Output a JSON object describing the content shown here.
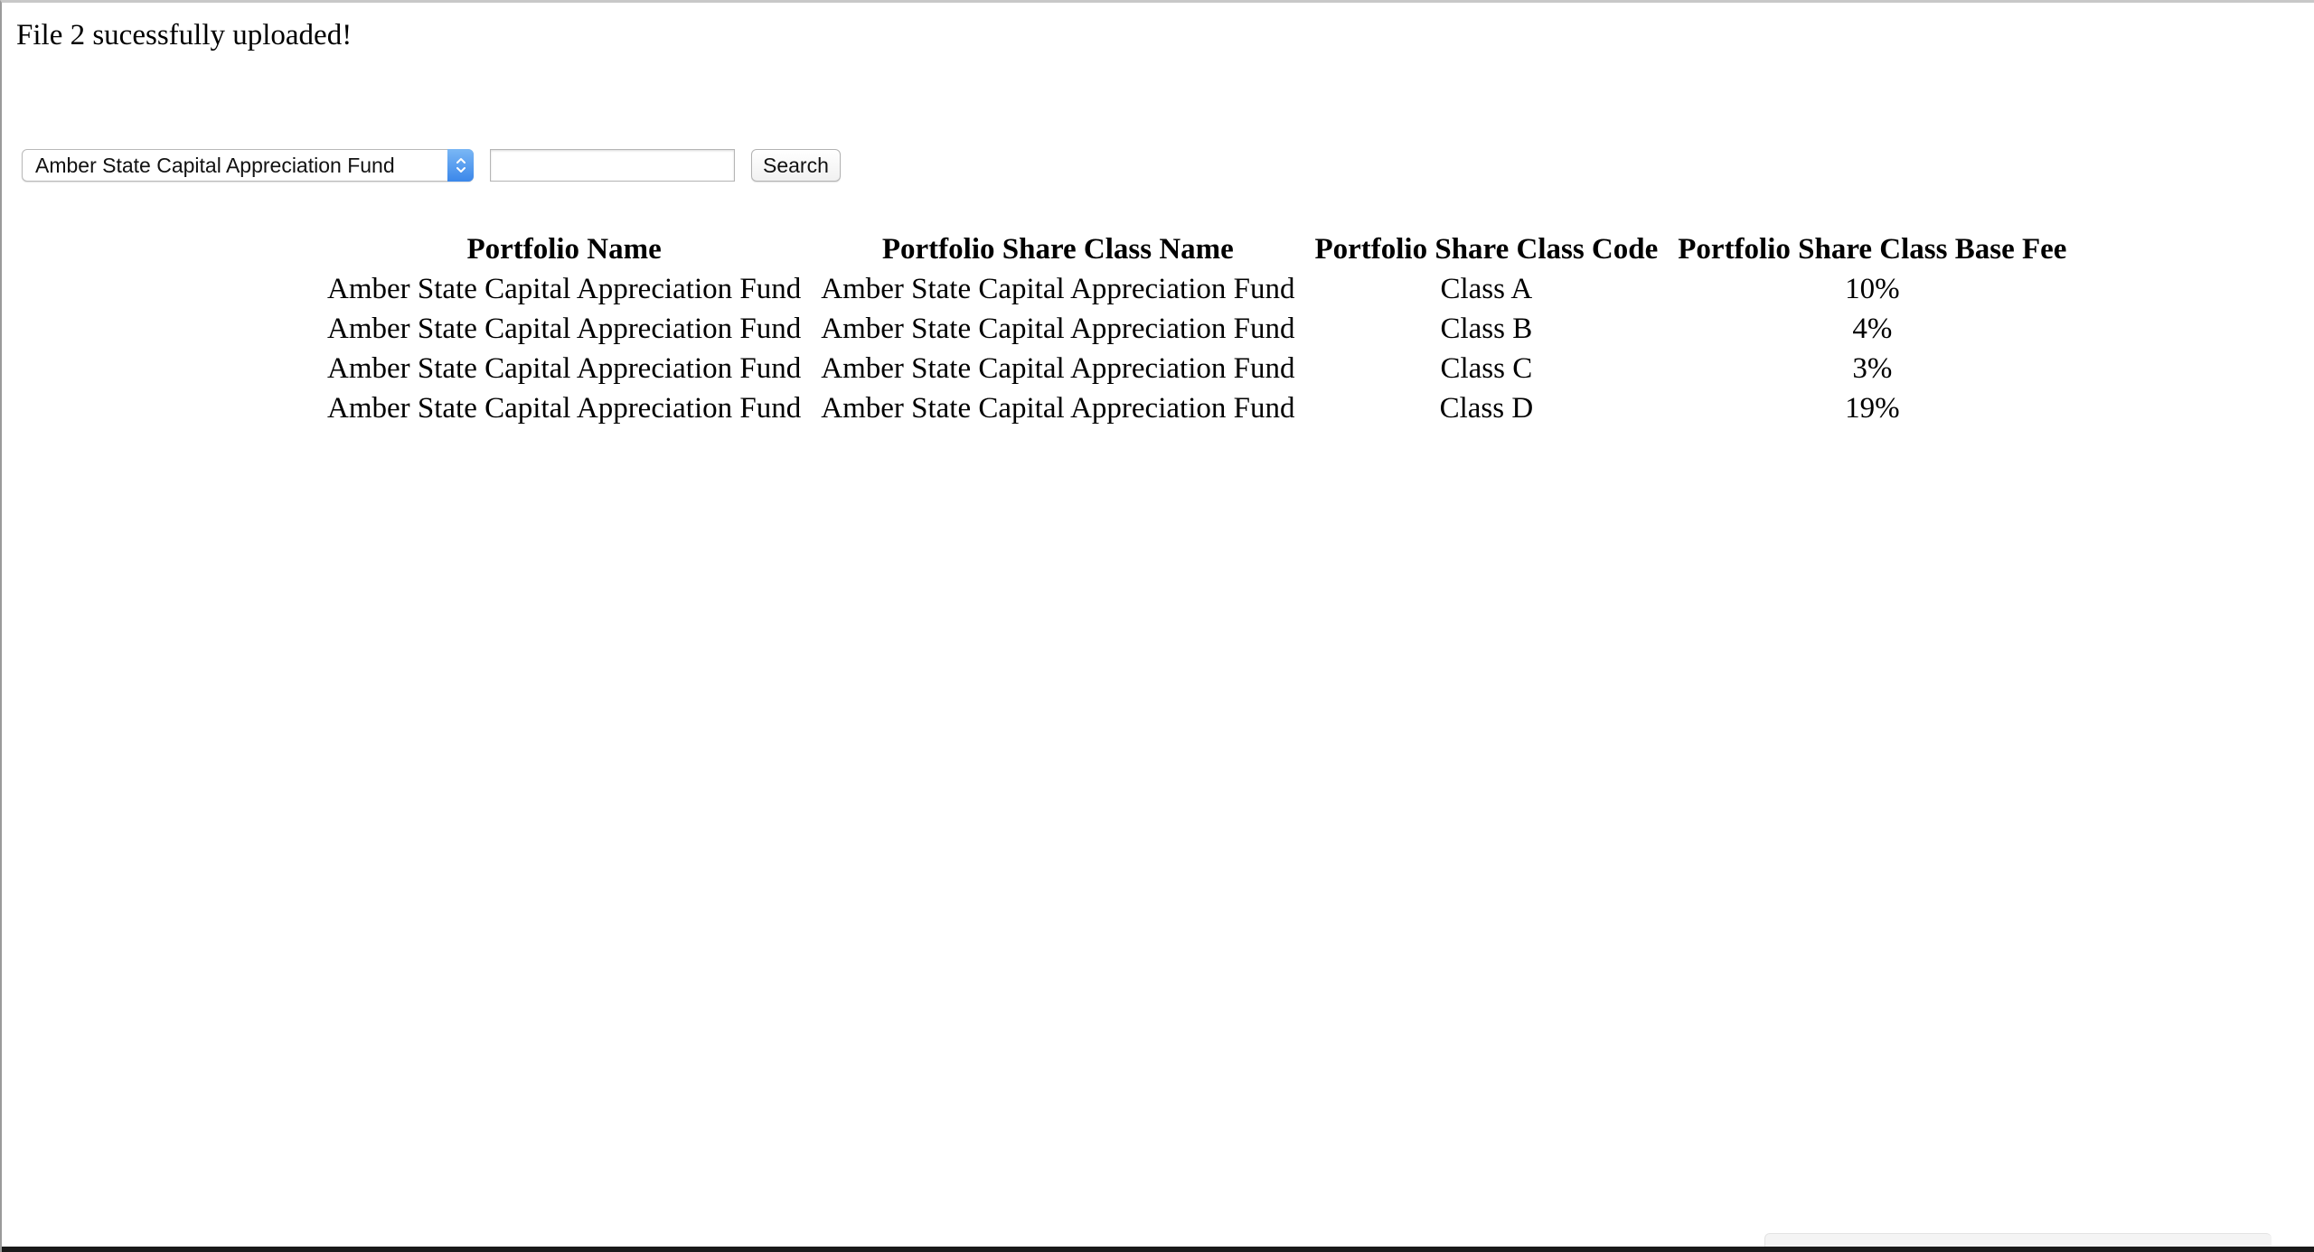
{
  "status": {
    "message": "File 2 sucessfully uploaded!"
  },
  "controls": {
    "portfolio_select": {
      "selected": "Amber State Capital Appreciation Fund"
    },
    "search_input": {
      "value": "",
      "placeholder": ""
    },
    "search_button_label": "Search"
  },
  "table": {
    "headers": [
      "Portfolio Name",
      "Portfolio Share Class Name",
      "Portfolio Share Class Code",
      "Portfolio Share Class Base Fee"
    ],
    "rows": [
      [
        "Amber State Capital Appreciation Fund",
        "Amber State Capital Appreciation Fund",
        "Class A",
        "10%"
      ],
      [
        "Amber State Capital Appreciation Fund",
        "Amber State Capital Appreciation Fund",
        "Class B",
        "4%"
      ],
      [
        "Amber State Capital Appreciation Fund",
        "Amber State Capital Appreciation Fund",
        "Class C",
        "3%"
      ],
      [
        "Amber State Capital Appreciation Fund",
        "Amber State Capital Appreciation Fund",
        "Class D",
        "19%"
      ]
    ]
  },
  "colors": {
    "select_accent": "#3b87ea"
  }
}
